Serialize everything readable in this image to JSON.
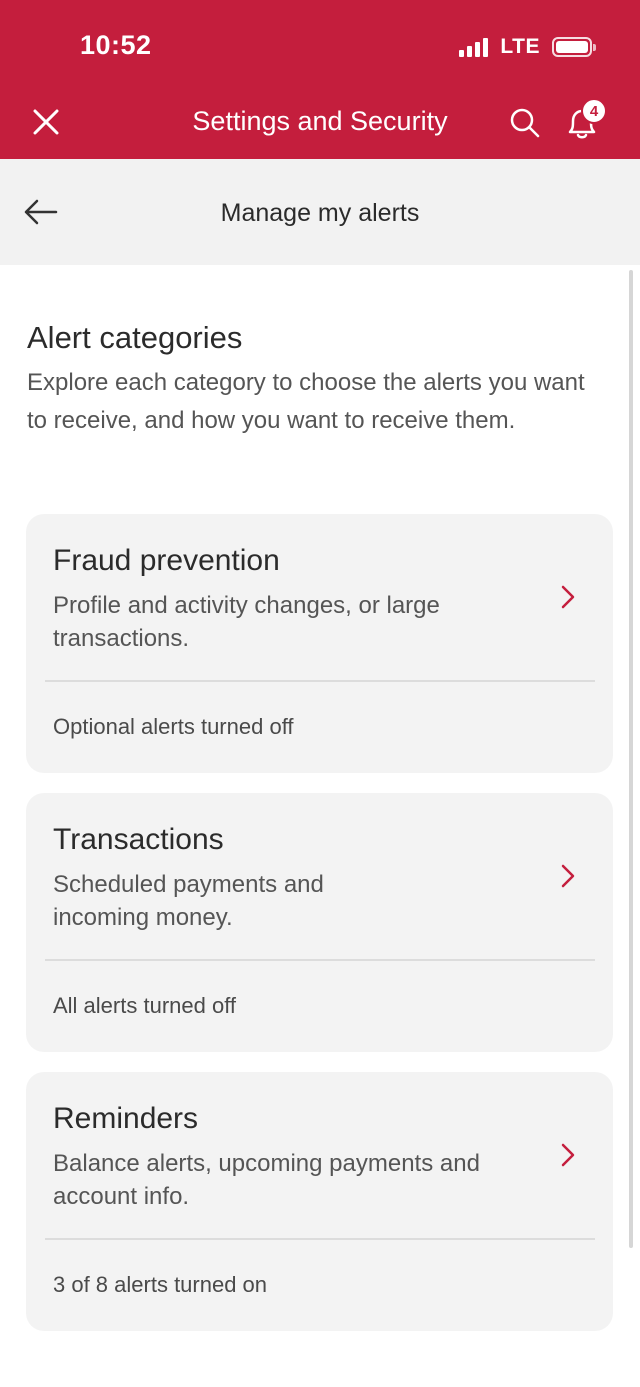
{
  "status_bar": {
    "time": "10:52",
    "network": "LTE"
  },
  "header": {
    "title": "Settings and Security",
    "notification_count": "4",
    "close_icon": "close-icon",
    "search_icon": "search-icon",
    "bell_icon": "bell-icon"
  },
  "subheader": {
    "title": "Manage my alerts",
    "back_icon": "arrow-left-icon"
  },
  "section": {
    "title": "Alert categories",
    "description": "Explore each category to choose the alerts you want to receive, and how you want to receive them."
  },
  "cards": [
    {
      "title": "Fraud prevention",
      "description": "Profile and activity changes, or large transactions.",
      "status": "Optional alerts turned off"
    },
    {
      "title": "Transactions",
      "description": "Scheduled payments and incoming money.",
      "status": "All alerts turned off"
    },
    {
      "title": "Reminders",
      "description": "Balance alerts, upcoming payments and account info.",
      "status": "3 of 8 alerts turned on"
    }
  ],
  "colors": {
    "brand": "#c41e3d",
    "card_bg": "#f3f3f3",
    "subheader_bg": "#f2f2f2"
  }
}
